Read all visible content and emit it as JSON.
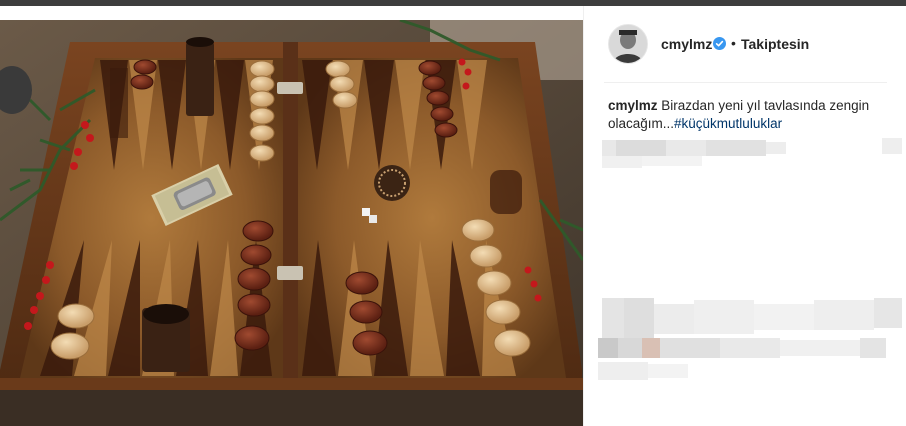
{
  "post": {
    "username": "cmylmz",
    "separator": "•",
    "follow_status": "Takiptesin",
    "caption_text": "Birazdan yeni yıl tavlasında zengin olacağım...",
    "hashtag": "#küçükmutluluklar"
  },
  "colors": {
    "verified_blue": "#3897f0",
    "hashtag_blue": "#003569",
    "text": "#262626"
  },
  "icons": {
    "verified": "verified-badge-icon"
  }
}
